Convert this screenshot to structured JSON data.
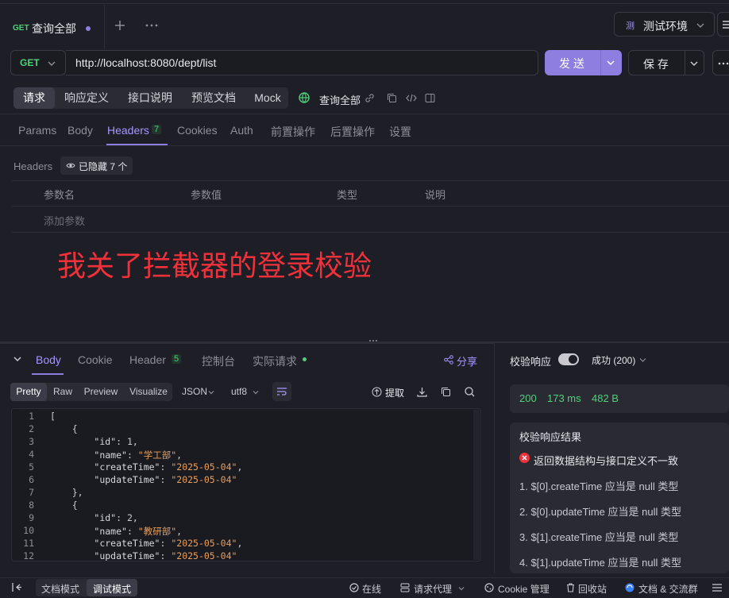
{
  "tabbar": {
    "method": "GET",
    "tab_title": "查询全部",
    "env_badge": "测",
    "env_name": "测试环境"
  },
  "request": {
    "method": "GET",
    "url": "http://localhost:8080/dept/list",
    "send": "发 送",
    "save": "保 存"
  },
  "subtabs": {
    "items": [
      "请求",
      "响应定义",
      "接口说明",
      "预览文档",
      "Mock"
    ],
    "name": "查询全部"
  },
  "param_tabs": {
    "params": "Params",
    "body": "Body",
    "headers": "Headers",
    "headers_count": "7",
    "cookies": "Cookies",
    "auth": "Auth",
    "pre": "前置操作",
    "post": "后置操作",
    "settings": "设置"
  },
  "headers": {
    "label": "Headers",
    "hidden": "已隐藏 7 个",
    "col_name": "参数名",
    "col_value": "参数值",
    "col_type": "类型",
    "col_desc": "说明",
    "add": "添加参数"
  },
  "annotation": "我关了拦截器的登录校验",
  "response_tabs": {
    "body": "Body",
    "cookie": "Cookie",
    "header": "Header",
    "header_count": "5",
    "console": "控制台",
    "actual": "实际请求",
    "share": "分享"
  },
  "format_bar": {
    "pretty": "Pretty",
    "raw": "Raw",
    "preview": "Preview",
    "visualize": "Visualize",
    "json": "JSON",
    "encoding": "utf8",
    "extract": "提取"
  },
  "code_lines": [
    {
      "n": "1",
      "t": "["
    },
    {
      "n": "2",
      "t": "    {"
    },
    {
      "n": "3",
      "t": "        \"id\": 1,"
    },
    {
      "n": "4",
      "t": "        \"name\": \"学工部\","
    },
    {
      "n": "5",
      "t": "        \"createTime\": \"2025-05-04\","
    },
    {
      "n": "6",
      "t": "        \"updateTime\": \"2025-05-04\""
    },
    {
      "n": "7",
      "t": "    },"
    },
    {
      "n": "8",
      "t": "    {"
    },
    {
      "n": "9",
      "t": "        \"id\": 2,"
    },
    {
      "n": "10",
      "t": "        \"name\": \"教研部\","
    },
    {
      "n": "11",
      "t": "        \"createTime\": \"2025-05-04\","
    },
    {
      "n": "12",
      "t": "        \"updateTime\": \"2025-05-04\""
    }
  ],
  "validation": {
    "label": "校验响应",
    "status": "成功 (200)",
    "code": "200",
    "time": "173 ms",
    "size": "482 B",
    "result_title": "校验响应结果",
    "error": "返回数据结构与接口定义不一致",
    "items": [
      "1. $[0].createTime 应当是 null 类型",
      "2. $[0].updateTime 应当是 null 类型",
      "3. $[1].createTime 应当是 null 类型",
      "4. $[1].updateTime 应当是 null 类型"
    ]
  },
  "bottombar": {
    "doc_mode": "文档模式",
    "debug_mode": "调试模式",
    "online": "在线",
    "proxy": "请求代理",
    "cookie": "Cookie 管理",
    "trash": "回收站",
    "community": "文档 & 交流群"
  },
  "colors": {
    "accent": "#8e7ee0",
    "success": "#4fd17a",
    "error": "#f0313a",
    "string": "#e8a05b"
  }
}
